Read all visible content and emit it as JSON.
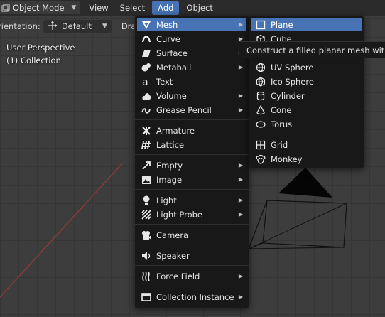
{
  "header": {
    "mode": "Object Mode",
    "menus": [
      "View",
      "Select",
      "Add",
      "Object"
    ],
    "active_menu": "Add"
  },
  "toolbar": {
    "orientation_label": "Orientation:",
    "orientation_value": "Default",
    "drag_label": "Drag"
  },
  "viewport": {
    "perspective": "User Perspective",
    "collection": "(1) Collection"
  },
  "add_menu": {
    "items": [
      {
        "label": "Mesh",
        "icon": "mesh-icon",
        "submenu": true,
        "highlighted": true
      },
      {
        "label": "Curve",
        "icon": "curve-icon",
        "submenu": true
      },
      {
        "label": "Surface",
        "icon": "surface-icon",
        "submenu": true
      },
      {
        "label": "Metaball",
        "icon": "metaball-icon",
        "submenu": true
      },
      {
        "label": "Text",
        "icon": "text-icon",
        "submenu": false
      },
      {
        "label": "Volume",
        "icon": "volume-icon",
        "submenu": true
      },
      {
        "label": "Grease Pencil",
        "icon": "grease-pencil-icon",
        "submenu": true
      },
      {
        "label": "Armature",
        "icon": "armature-icon",
        "submenu": false
      },
      {
        "label": "Lattice",
        "icon": "lattice-icon",
        "submenu": false
      },
      {
        "label": "Empty",
        "icon": "empty-icon",
        "submenu": true
      },
      {
        "label": "Image",
        "icon": "image-icon",
        "submenu": true
      },
      {
        "label": "Light",
        "icon": "light-icon",
        "submenu": true
      },
      {
        "label": "Light Probe",
        "icon": "light-probe-icon",
        "submenu": true
      },
      {
        "label": "Camera",
        "icon": "camera-icon",
        "submenu": false
      },
      {
        "label": "Speaker",
        "icon": "speaker-icon",
        "submenu": false
      },
      {
        "label": "Force Field",
        "icon": "force-field-icon",
        "submenu": true
      },
      {
        "label": "Collection Instance",
        "icon": "collection-instance-icon",
        "submenu": true
      }
    ]
  },
  "mesh_submenu": {
    "items": [
      {
        "label": "Plane",
        "icon": "plane-icon",
        "highlighted": true
      },
      {
        "label": "Cube",
        "icon": "cube-icon"
      },
      {
        "label": "Circle",
        "icon": "circle-icon"
      },
      {
        "label": "UV Sphere",
        "icon": "uv-sphere-icon"
      },
      {
        "label": "Ico Sphere",
        "icon": "ico-sphere-icon"
      },
      {
        "label": "Cylinder",
        "icon": "cylinder-icon"
      },
      {
        "label": "Cone",
        "icon": "cone-icon"
      },
      {
        "label": "Torus",
        "icon": "torus-icon"
      },
      {
        "label": "Grid",
        "icon": "grid-icon"
      },
      {
        "label": "Monkey",
        "icon": "monkey-icon"
      }
    ]
  },
  "tooltip": {
    "text": "Construct a filled planar mesh with 4 vertices"
  },
  "colors": {
    "highlight": "#4772b3",
    "menu_bg": "#181818",
    "header_bg": "#2b2b2b",
    "viewport_bg": "#3d3d3d"
  }
}
